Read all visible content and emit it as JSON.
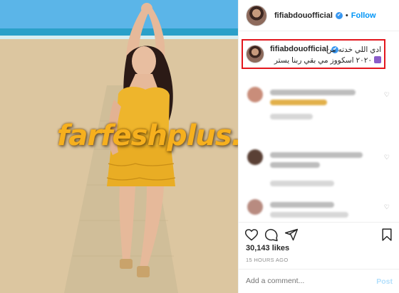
{
  "post": {
    "username": "fifiabdouofficial",
    "verified_badge": "✔",
    "follow_label": "Follow",
    "separator": "•",
    "caption_line1": "ادي اللي خدته من",
    "caption_line2": "٢٠٢٠ اسكووز مي بقي ربنا يستر",
    "likes": "30,143 likes",
    "timestamp": "15 HOURS AGO",
    "comment_placeholder": "Add a comment...",
    "post_label": "Post"
  },
  "watermark": "farfeshplus.com",
  "icons": {
    "like": "heart-icon",
    "comment": "comment-icon",
    "share": "share-icon",
    "save": "bookmark-icon"
  },
  "colors": {
    "accent": "#0095f6",
    "highlight_box": "#e3161d",
    "watermark": "#f6b01e"
  }
}
